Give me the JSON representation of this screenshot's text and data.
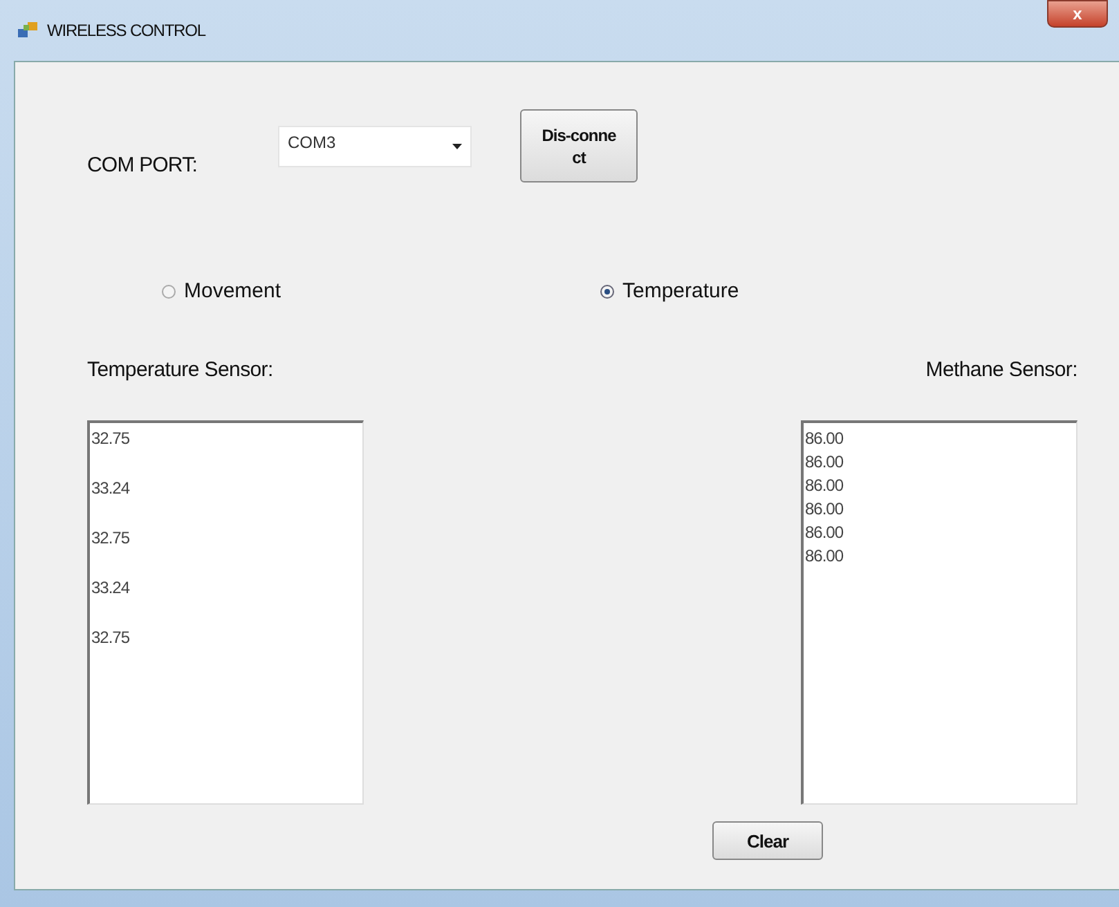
{
  "window": {
    "title": "WIRELESS CONTROL",
    "close": "x"
  },
  "com_port": {
    "label": "COM PORT:",
    "value": "COM3"
  },
  "connect_button": "Dis-connect",
  "mode_radios": [
    {
      "label": "Movement",
      "selected": false
    },
    {
      "label": "Temperature",
      "selected": true
    }
  ],
  "sensors": [
    {
      "title": "Temperature Sensor:",
      "readings": [
        "32.75",
        "33.24",
        "32.75",
        "33.24",
        "32.75"
      ]
    },
    {
      "title": "Methane Sensor:",
      "readings": [
        "86.00",
        "86.00",
        "86.00",
        "86.00",
        "86.00",
        "86.00"
      ]
    }
  ],
  "clear_button": "Clear"
}
